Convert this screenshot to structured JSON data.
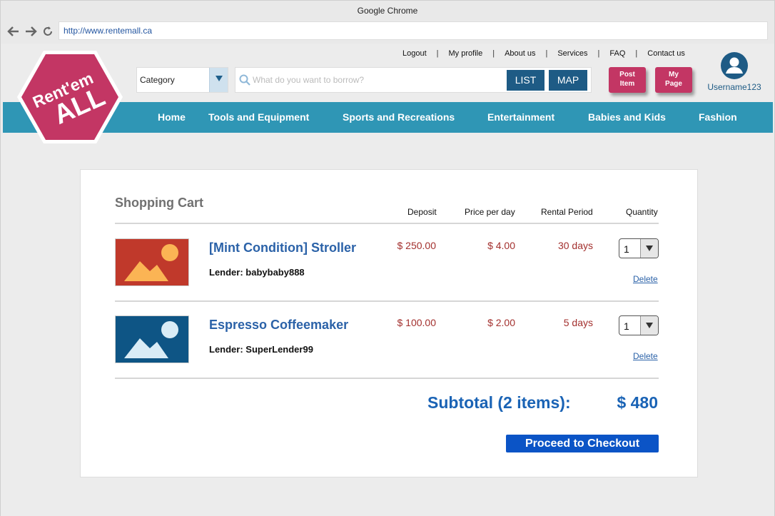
{
  "browser": {
    "title": "Google Chrome",
    "url": "http://www.rentemall.ca"
  },
  "logo": {
    "line1": "Rent'em",
    "line2": "ALL",
    "color": "#c33664"
  },
  "top_links": [
    "Logout",
    "My profile",
    "About us",
    "Services",
    "FAQ",
    "Contact us"
  ],
  "search": {
    "category_label": "Category",
    "placeholder": "What do you want to borrow?",
    "list_label": "LIST",
    "map_label": "MAP"
  },
  "actions": {
    "post_item": [
      "Post",
      "Item"
    ],
    "my_page": [
      "My",
      "Page"
    ]
  },
  "user": {
    "username": "Username123"
  },
  "menu": [
    "Home",
    "Tools and Equipment",
    "Sports and Recreations",
    "Entertainment",
    "Babies and Kids",
    "Fashion"
  ],
  "cart": {
    "title": "Shopping Cart",
    "columns": {
      "deposit": "Deposit",
      "price": "Price per day",
      "period": "Rental Period",
      "quantity": "Quantity"
    },
    "items": [
      {
        "title": "[Mint Condition] Stroller",
        "lender": "Lender: babybaby888",
        "deposit": "$ 250.00",
        "price": "$ 4.00",
        "period": "30 days",
        "quantity": "1",
        "delete_label": "Delete",
        "thumb_color": "#c0392b"
      },
      {
        "title": "Espresso Coffeemaker",
        "lender": "Lender: SuperLender99",
        "deposit": "$ 100.00",
        "price": "$ 2.00",
        "period": "5 days",
        "quantity": "1",
        "delete_label": "Delete",
        "thumb_color": "#0e5585"
      }
    ],
    "subtotal_label": "Subtotal (2 items):",
    "subtotal_value": "$ 480",
    "checkout_label": "Proceed to Checkout"
  }
}
